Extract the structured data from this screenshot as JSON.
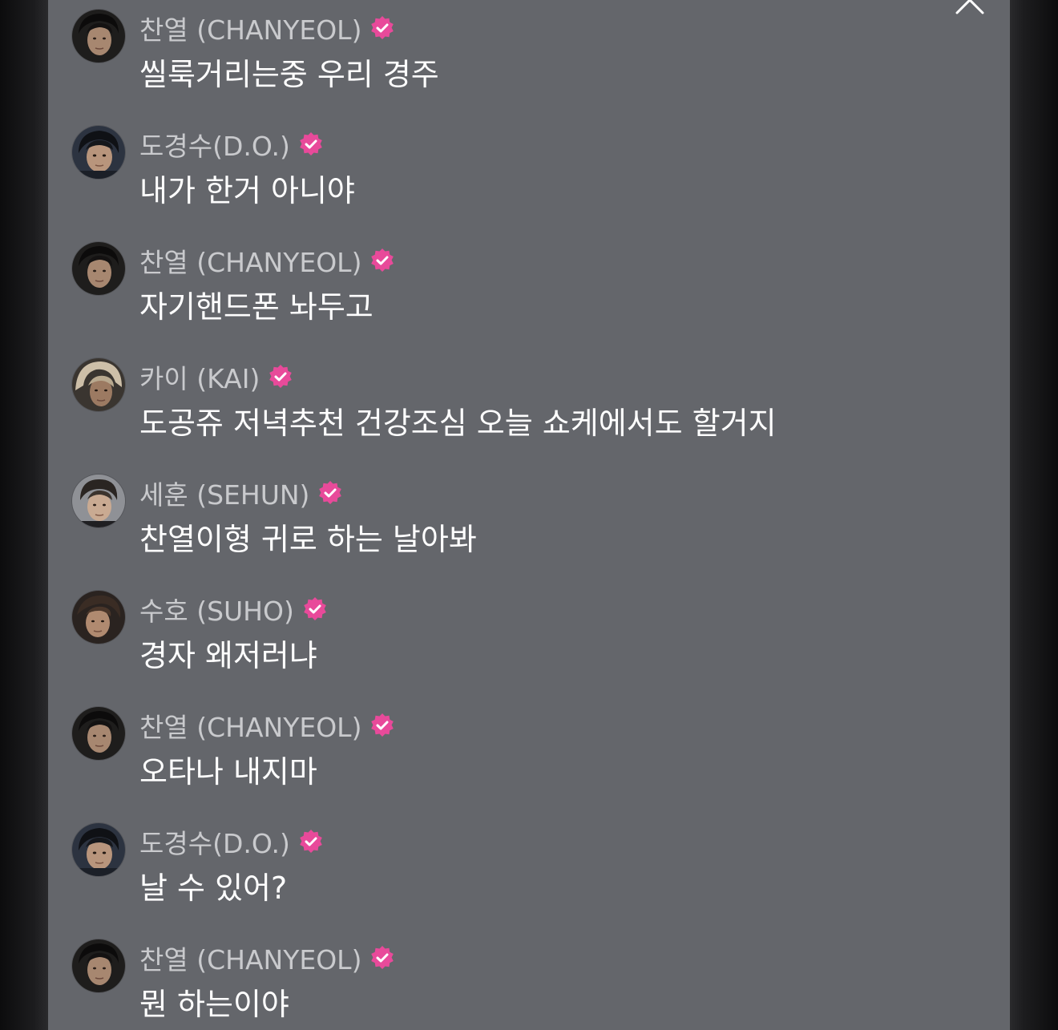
{
  "panel": {
    "close_icon": "close-icon",
    "badge_color": "#e84a9a",
    "bg_color": "#64666b"
  },
  "messages": [
    {
      "author": "찬열 (CHANYEOL)",
      "text": "씰룩거리는중 우리 경주",
      "verified": true,
      "avatar": "chanyeol"
    },
    {
      "author": "도경수(D.O.)",
      "text": "내가 한거 아니야",
      "verified": true,
      "avatar": "do"
    },
    {
      "author": "찬열 (CHANYEOL)",
      "text": "자기핸드폰 놔두고",
      "verified": true,
      "avatar": "chanyeol"
    },
    {
      "author": "카이 (KAI)",
      "text": "도공쥬 저녁추천 건강조심 오늘 쇼케에서도 할거지",
      "verified": true,
      "avatar": "kai"
    },
    {
      "author": "세훈 (SEHUN)",
      "text": "찬열이형 귀로 하는 날아봐",
      "verified": true,
      "avatar": "sehun"
    },
    {
      "author": "수호 (SUHO)",
      "text": "경자 왜저러냐",
      "verified": true,
      "avatar": "suho"
    },
    {
      "author": "찬열 (CHANYEOL)",
      "text": "오타나 내지마",
      "verified": true,
      "avatar": "chanyeol"
    },
    {
      "author": "도경수(D.O.)",
      "text": "날 수 있어?",
      "verified": true,
      "avatar": "do"
    },
    {
      "author": "찬열 (CHANYEOL)",
      "text": "뭔 하는이야",
      "verified": true,
      "avatar": "chanyeol"
    }
  ]
}
